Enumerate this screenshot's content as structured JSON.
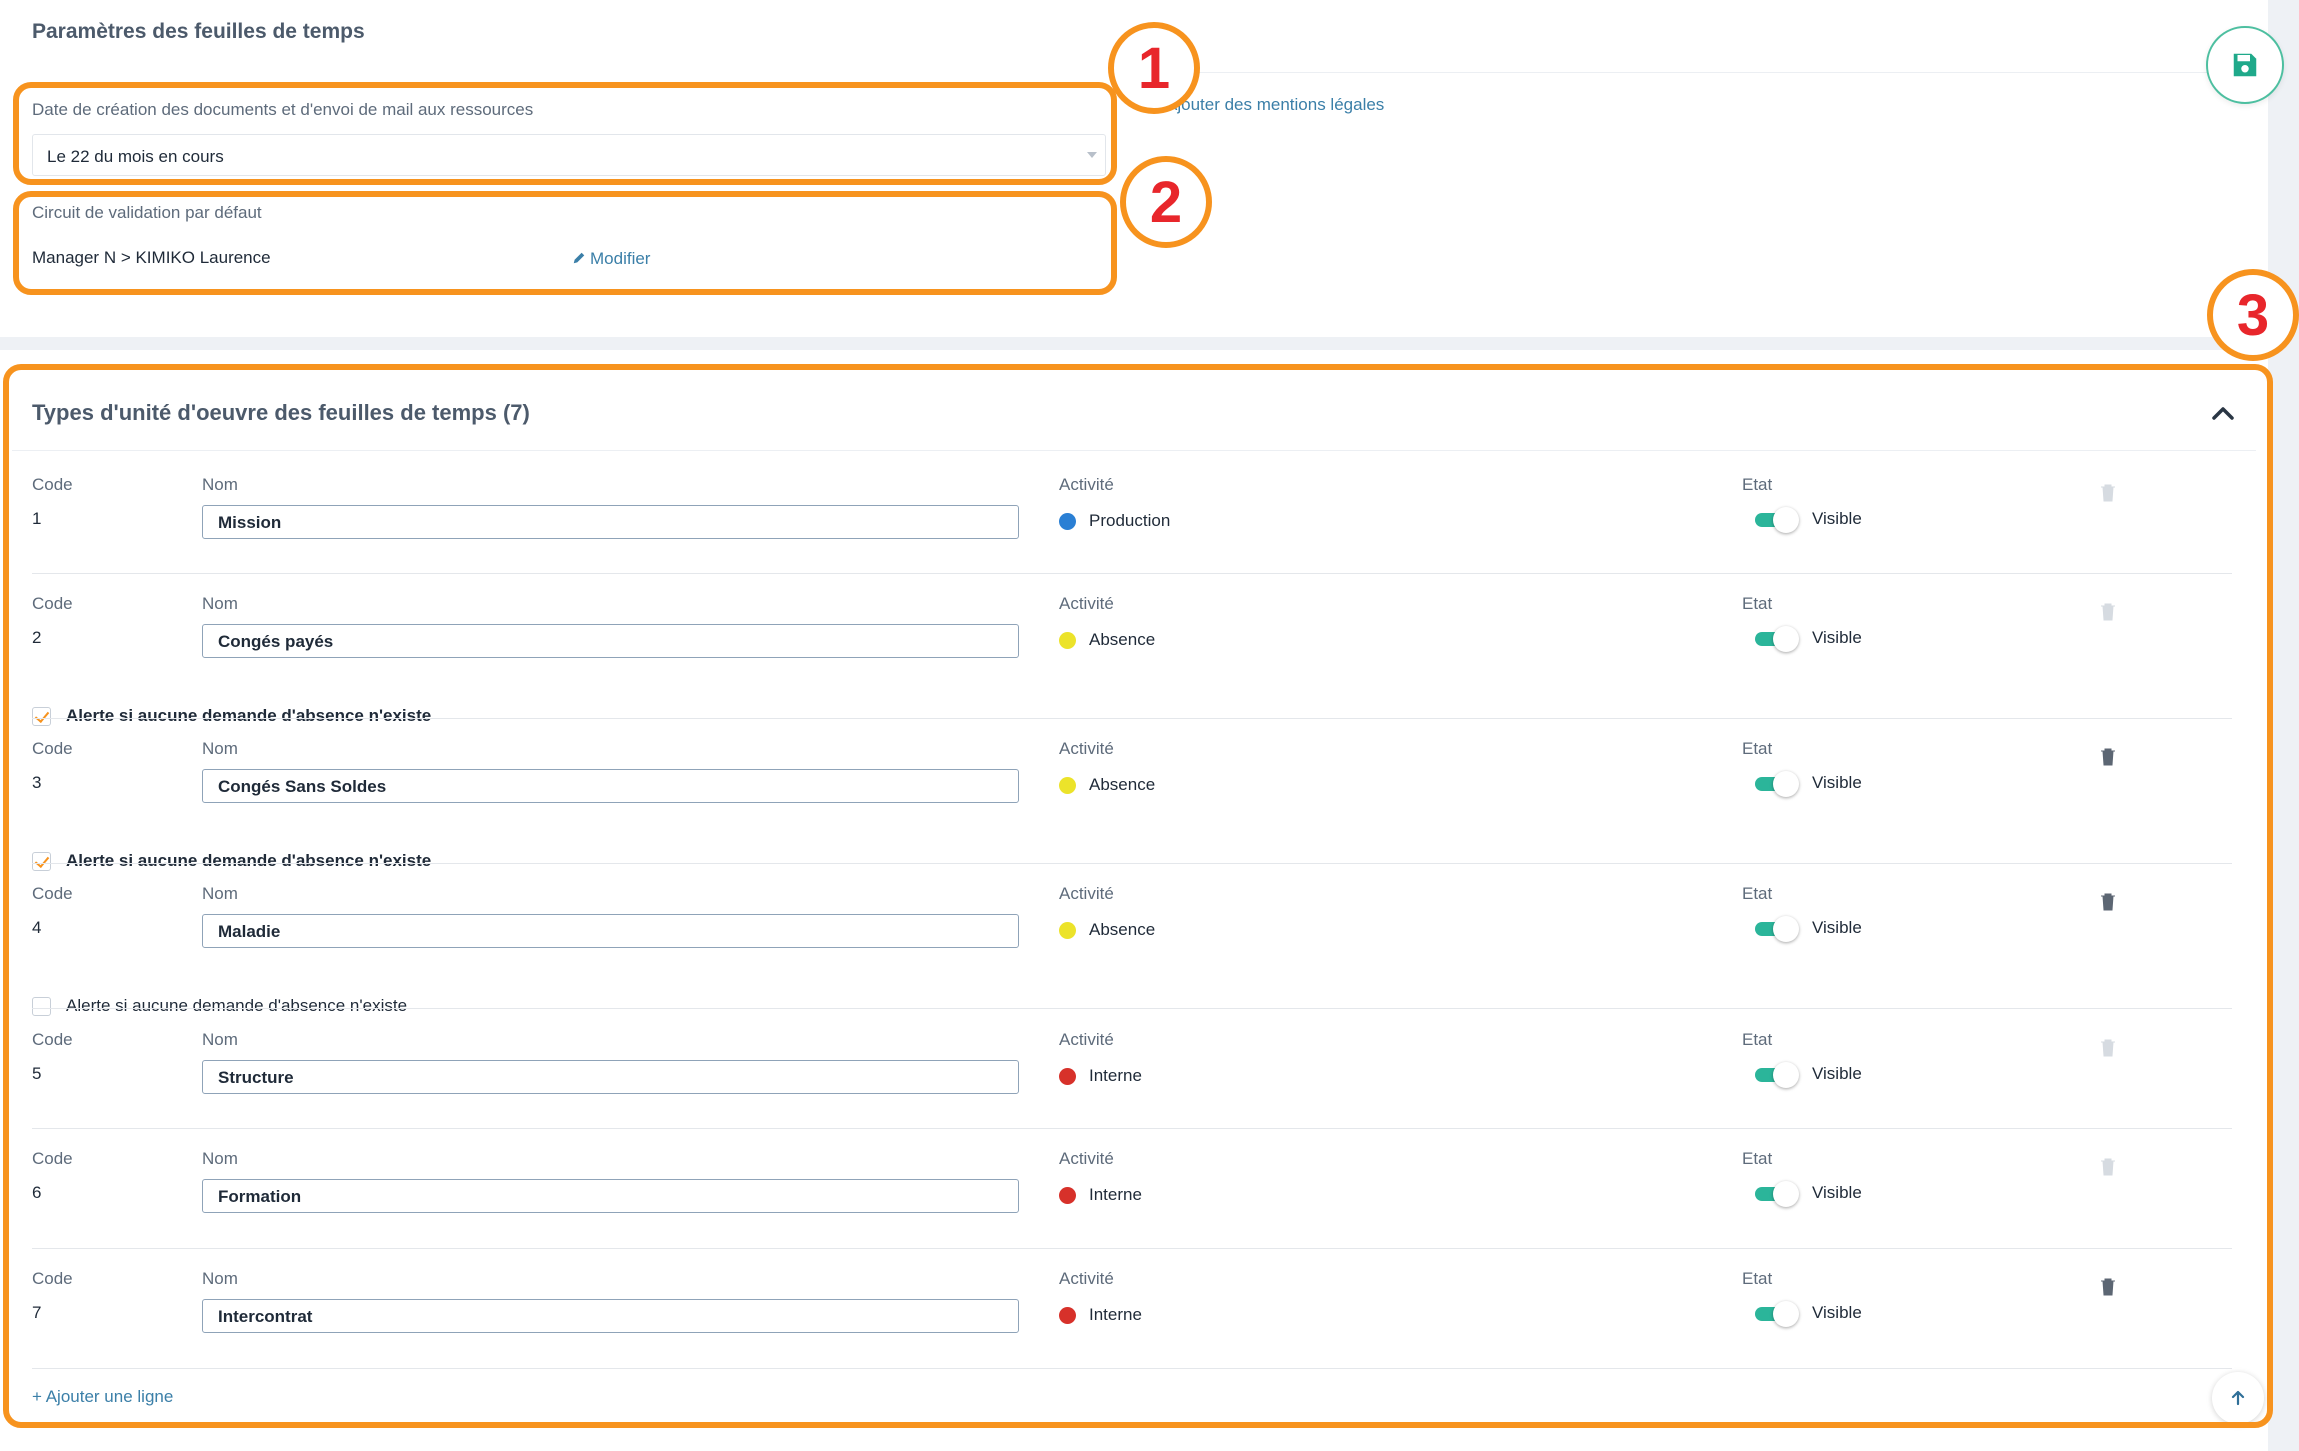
{
  "settings": {
    "title": "Paramètres des feuilles de temps",
    "creation_date_label": "Date de création des documents et d'envoi de mail aux ressources",
    "creation_date_value": "Le 22 du mois en cours",
    "legal_mentions_link": "Ajouter des mentions légales",
    "validation_label": "Circuit de validation par défaut",
    "validation_value": "Manager N > KIMIKO Laurence",
    "modify_link": "Modifier",
    "save_icon": "save-icon"
  },
  "annotations": [
    "1",
    "2",
    "3"
  ],
  "types": {
    "title": "Types d'unité d'oeuvre des feuilles de temps (7)",
    "labels": {
      "code": "Code",
      "name": "Nom",
      "activity": "Activité",
      "state": "Etat"
    },
    "alert_label": "Alerte si aucune demande d'absence n'existe",
    "add_line": "+ Ajouter une ligne",
    "rows": [
      {
        "code": "1",
        "name": "Mission",
        "activity": "Production",
        "activity_color": "#2a7fd4",
        "state": "Visible",
        "visible": true,
        "trash_enabled": false,
        "alert": null
      },
      {
        "code": "2",
        "name": "Congés payés",
        "activity": "Absence",
        "activity_color": "#ece32a",
        "state": "Visible",
        "visible": true,
        "trash_enabled": false,
        "alert": true
      },
      {
        "code": "3",
        "name": "Congés Sans Soldes",
        "activity": "Absence",
        "activity_color": "#ece32a",
        "state": "Visible",
        "visible": true,
        "trash_enabled": true,
        "alert": true
      },
      {
        "code": "4",
        "name": "Maladie",
        "activity": "Absence",
        "activity_color": "#ece32a",
        "state": "Visible",
        "visible": true,
        "trash_enabled": true,
        "alert": false
      },
      {
        "code": "5",
        "name": "Structure",
        "activity": "Interne",
        "activity_color": "#d7312a",
        "state": "Visible",
        "visible": true,
        "trash_enabled": false,
        "alert": null
      },
      {
        "code": "6",
        "name": "Formation",
        "activity": "Interne",
        "activity_color": "#d7312a",
        "state": "Visible",
        "visible": true,
        "trash_enabled": false,
        "alert": null
      },
      {
        "code": "7",
        "name": "Intercontrat",
        "activity": "Interne",
        "activity_color": "#d7312a",
        "state": "Visible",
        "visible": true,
        "trash_enabled": true,
        "alert": null
      }
    ]
  },
  "colors": {
    "accent": "#3b7fa8",
    "annotation": "#f7931e",
    "annotation_number": "#e8262b",
    "toggle_on": "#2bb59a"
  }
}
